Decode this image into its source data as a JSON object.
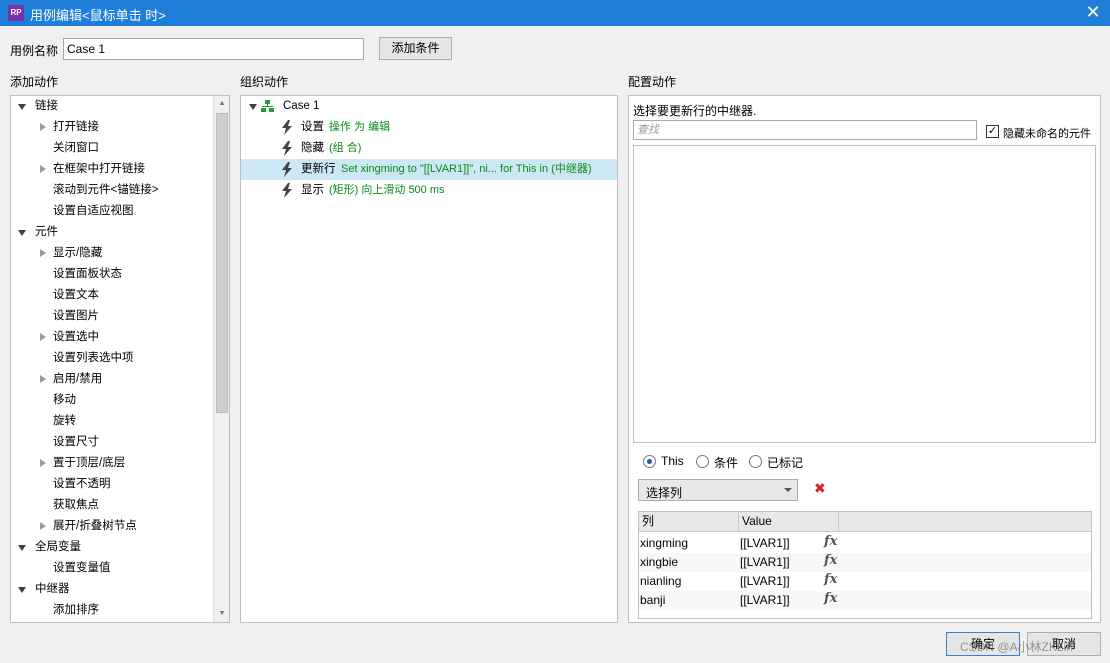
{
  "window": {
    "app_icon": "RP",
    "title": "用例编辑<鼠标单击 时>",
    "close": "✕"
  },
  "case_name": {
    "label": "用例名称",
    "value": "Case 1",
    "add_condition": "添加条件"
  },
  "add_actions": {
    "header": "添加动作",
    "items": [
      {
        "label": "链接",
        "level": 0,
        "expander": "down"
      },
      {
        "label": "打开链接",
        "level": 1,
        "expander": "right"
      },
      {
        "label": "关闭窗口",
        "level": 1,
        "expander": "none"
      },
      {
        "label": "在框架中打开链接",
        "level": 1,
        "expander": "right"
      },
      {
        "label": "滚动到元件<锚链接>",
        "level": 1,
        "expander": "none"
      },
      {
        "label": "设置自适应视图",
        "level": 1,
        "expander": "none"
      },
      {
        "label": "元件",
        "level": 0,
        "expander": "down"
      },
      {
        "label": "显示/隐藏",
        "level": 1,
        "expander": "right"
      },
      {
        "label": "设置面板状态",
        "level": 1,
        "expander": "none"
      },
      {
        "label": "设置文本",
        "level": 1,
        "expander": "none"
      },
      {
        "label": "设置图片",
        "level": 1,
        "expander": "none"
      },
      {
        "label": "设置选中",
        "level": 1,
        "expander": "right"
      },
      {
        "label": "设置列表选中项",
        "level": 1,
        "expander": "none"
      },
      {
        "label": "启用/禁用",
        "level": 1,
        "expander": "right"
      },
      {
        "label": "移动",
        "level": 1,
        "expander": "none"
      },
      {
        "label": "旋转",
        "level": 1,
        "expander": "none"
      },
      {
        "label": "设置尺寸",
        "level": 1,
        "expander": "none"
      },
      {
        "label": "置于顶层/底层",
        "level": 1,
        "expander": "right"
      },
      {
        "label": "设置不透明",
        "level": 1,
        "expander": "none"
      },
      {
        "label": "获取焦点",
        "level": 1,
        "expander": "none"
      },
      {
        "label": "展开/折叠树节点",
        "level": 1,
        "expander": "right"
      },
      {
        "label": "全局变量",
        "level": 0,
        "expander": "down"
      },
      {
        "label": "设置变量值",
        "level": 1,
        "expander": "none"
      },
      {
        "label": "中继器",
        "level": 0,
        "expander": "down"
      },
      {
        "label": "添加排序",
        "level": 1,
        "expander": "none"
      }
    ]
  },
  "organize": {
    "header": "组织动作",
    "case_label": "Case 1",
    "actions": [
      {
        "verb": "设置",
        "detail": "操作 为 编辑",
        "selected": false
      },
      {
        "verb": "隐藏",
        "detail": "(组 合)",
        "selected": false
      },
      {
        "verb": "更新行",
        "detail": "Set xingming to \"[[LVAR1]]\", ni... for This in (中继器)",
        "selected": true
      },
      {
        "verb": "显示",
        "detail": "(矩形) 向上滑动 500 ms",
        "selected": false
      }
    ]
  },
  "configure": {
    "header": "配置动作",
    "prompt": "选择要更新行的中继器.",
    "search_placeholder": "查找",
    "hide_unnamed_label": "隐藏未命名的元件",
    "hide_unnamed_checked": true,
    "radio_options": [
      {
        "label": "This",
        "checked": true
      },
      {
        "label": "条件",
        "checked": false
      },
      {
        "label": "已标记",
        "checked": false
      }
    ],
    "select_column": "选择列",
    "delete_icon": "✖",
    "table_headers": [
      "列",
      "Value"
    ],
    "rows": [
      {
        "column": "xingming",
        "value": "[[LVAR1]]",
        "fx": "fx"
      },
      {
        "column": "xingbie",
        "value": "[[LVAR1]]",
        "fx": "fx"
      },
      {
        "column": "nianling",
        "value": "[[LVAR1]]",
        "fx": "fx"
      },
      {
        "column": "banji",
        "value": "[[LVAR1]]",
        "fx": "fx"
      }
    ]
  },
  "footer": {
    "ok": "确定",
    "cancel": "取消",
    "watermark": "CSDN @A小林ZKLin"
  },
  "colors": {
    "titlebar": "#1f7fd8",
    "selection": "#cce8f4",
    "green_text": "#0a8a1a",
    "delete_red": "#e02020"
  }
}
